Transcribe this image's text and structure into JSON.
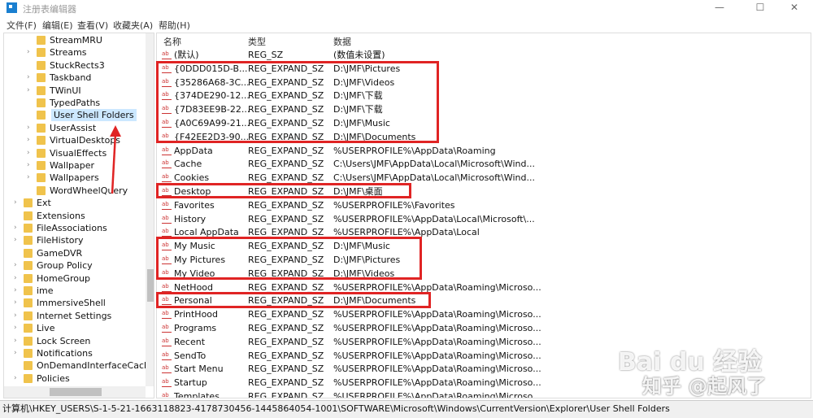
{
  "window": {
    "title": "注册表编辑器",
    "minimize": "—",
    "maximize": "☐",
    "close": "✕"
  },
  "menu": [
    "文件(F)",
    "编辑(E)",
    "查看(V)",
    "收藏夹(A)",
    "帮助(H)"
  ],
  "tree": [
    {
      "label": "StreamMRU",
      "expander": false,
      "level": 2
    },
    {
      "label": "Streams",
      "expander": true,
      "level": 2
    },
    {
      "label": "StuckRects3",
      "expander": false,
      "level": 2
    },
    {
      "label": "Taskband",
      "expander": true,
      "level": 2
    },
    {
      "label": "TWinUI",
      "expander": true,
      "level": 2
    },
    {
      "label": "TypedPaths",
      "expander": false,
      "level": 2
    },
    {
      "label": "User Shell Folders",
      "expander": false,
      "level": 2,
      "selected": true
    },
    {
      "label": "UserAssist",
      "expander": true,
      "level": 2
    },
    {
      "label": "VirtualDesktops",
      "expander": true,
      "level": 2
    },
    {
      "label": "VisualEffects",
      "expander": true,
      "level": 2
    },
    {
      "label": "Wallpaper",
      "expander": true,
      "level": 2
    },
    {
      "label": "Wallpapers",
      "expander": true,
      "level": 2
    },
    {
      "label": "WordWheelQuery",
      "expander": false,
      "level": 2
    },
    {
      "label": "Ext",
      "expander": true,
      "level": 1
    },
    {
      "label": "Extensions",
      "expander": false,
      "level": 1
    },
    {
      "label": "FileAssociations",
      "expander": true,
      "level": 1
    },
    {
      "label": "FileHistory",
      "expander": true,
      "level": 1
    },
    {
      "label": "GameDVR",
      "expander": false,
      "level": 1
    },
    {
      "label": "Group Policy",
      "expander": true,
      "level": 1
    },
    {
      "label": "HomeGroup",
      "expander": true,
      "level": 1
    },
    {
      "label": "ime",
      "expander": true,
      "level": 1
    },
    {
      "label": "ImmersiveShell",
      "expander": true,
      "level": 1
    },
    {
      "label": "Internet Settings",
      "expander": true,
      "level": 1
    },
    {
      "label": "Live",
      "expander": true,
      "level": 1
    },
    {
      "label": "Lock Screen",
      "expander": true,
      "level": 1
    },
    {
      "label": "Notifications",
      "expander": true,
      "level": 1
    },
    {
      "label": "OnDemandInterfaceCache",
      "expander": false,
      "level": 1
    },
    {
      "label": "Policies",
      "expander": true,
      "level": 1
    },
    {
      "label": "RecentDocs",
      "expander": true,
      "level": 1
    }
  ],
  "columns": {
    "name": "名称",
    "type": "类型",
    "data": "数据"
  },
  "values": [
    {
      "name": "(默认)",
      "type": "REG_SZ",
      "data": "(数值未设置)"
    },
    {
      "name": "{0DDD015D-B...",
      "type": "REG_EXPAND_SZ",
      "data": "D:\\JMF\\Pictures"
    },
    {
      "name": "{35286A68-3C...",
      "type": "REG_EXPAND_SZ",
      "data": "D:\\JMF\\Videos"
    },
    {
      "name": "{374DE290-12...",
      "type": "REG_EXPAND_SZ",
      "data": "D:\\JMF\\下载"
    },
    {
      "name": "{7D83EE9B-22...",
      "type": "REG_EXPAND_SZ",
      "data": "D:\\JMF\\下载"
    },
    {
      "name": "{A0C69A99-21...",
      "type": "REG_EXPAND_SZ",
      "data": "D:\\JMF\\Music"
    },
    {
      "name": "{F42EE2D3-90...",
      "type": "REG_EXPAND_SZ",
      "data": "D:\\JMF\\Documents"
    },
    {
      "name": "AppData",
      "type": "REG_EXPAND_SZ",
      "data": "%USERPROFILE%\\AppData\\Roaming"
    },
    {
      "name": "Cache",
      "type": "REG_EXPAND_SZ",
      "data": "C:\\Users\\JMF\\AppData\\Local\\Microsoft\\Wind..."
    },
    {
      "name": "Cookies",
      "type": "REG_EXPAND_SZ",
      "data": "C:\\Users\\JMF\\AppData\\Local\\Microsoft\\Wind..."
    },
    {
      "name": "Desktop",
      "type": "REG_EXPAND_SZ",
      "data": "D:\\JMF\\桌面"
    },
    {
      "name": "Favorites",
      "type": "REG_EXPAND_SZ",
      "data": "%USERPROFILE%\\Favorites"
    },
    {
      "name": "History",
      "type": "REG_EXPAND_SZ",
      "data": "%USERPROFILE%\\AppData\\Local\\Microsoft\\..."
    },
    {
      "name": "Local AppData",
      "type": "REG_EXPAND_SZ",
      "data": "%USERPROFILE%\\AppData\\Local"
    },
    {
      "name": "My Music",
      "type": "REG_EXPAND_SZ",
      "data": "D:\\JMF\\Music"
    },
    {
      "name": "My Pictures",
      "type": "REG_EXPAND_SZ",
      "data": "D:\\JMF\\Pictures"
    },
    {
      "name": "My Video",
      "type": "REG_EXPAND_SZ",
      "data": "D:\\JMF\\Videos"
    },
    {
      "name": "NetHood",
      "type": "REG_EXPAND_SZ",
      "data": "%USERPROFILE%\\AppData\\Roaming\\Microso..."
    },
    {
      "name": "Personal",
      "type": "REG_EXPAND_SZ",
      "data": "D:\\JMF\\Documents"
    },
    {
      "name": "PrintHood",
      "type": "REG_EXPAND_SZ",
      "data": "%USERPROFILE%\\AppData\\Roaming\\Microso..."
    },
    {
      "name": "Programs",
      "type": "REG_EXPAND_SZ",
      "data": "%USERPROFILE%\\AppData\\Roaming\\Microso..."
    },
    {
      "name": "Recent",
      "type": "REG_EXPAND_SZ",
      "data": "%USERPROFILE%\\AppData\\Roaming\\Microso..."
    },
    {
      "name": "SendTo",
      "type": "REG_EXPAND_SZ",
      "data": "%USERPROFILE%\\AppData\\Roaming\\Microso..."
    },
    {
      "name": "Start Menu",
      "type": "REG_EXPAND_SZ",
      "data": "%USERPROFILE%\\AppData\\Roaming\\Microso..."
    },
    {
      "name": "Startup",
      "type": "REG_EXPAND_SZ",
      "data": "%USERPROFILE%\\AppData\\Roaming\\Microso..."
    },
    {
      "name": "Templates",
      "type": "REG_EXPAND_SZ",
      "data": "%USERPROFILE%\\AppData\\Roaming\\Microso..."
    }
  ],
  "status": "计算机\\HKEY_USERS\\S-1-5-21-1663118823-4178730456-1445864054-1001\\SOFTWARE\\Microsoft\\Windows\\CurrentVersion\\Explorer\\User Shell Folders",
  "watermark": {
    "baidu": "Bai du 经验",
    "zhihu": "知乎 @起风了"
  },
  "colors": {
    "highlight": "#e02424",
    "selection": "#cce8ff",
    "folder": "#f0c34c"
  }
}
